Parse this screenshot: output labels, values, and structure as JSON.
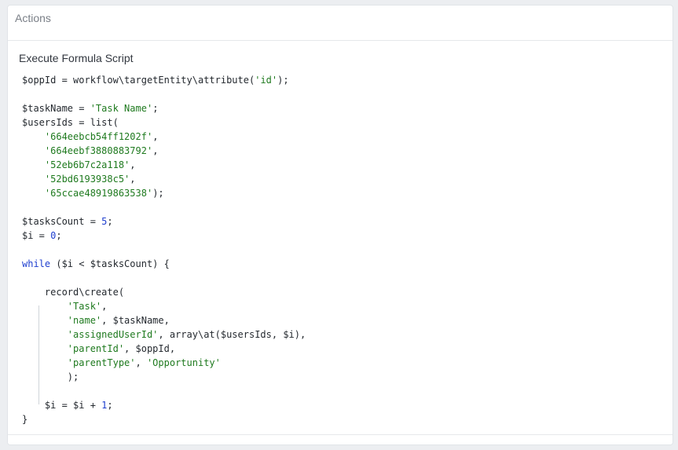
{
  "panel": {
    "title": "Actions"
  },
  "action": {
    "title": "Execute Formula Script"
  },
  "code": {
    "lines": [
      [
        {
          "t": "$oppId = workflow\\targetEntity\\attribute("
        },
        {
          "t": "'id'",
          "c": "s"
        },
        {
          "t": ");"
        }
      ],
      [],
      [
        {
          "t": "$taskName = "
        },
        {
          "t": "'Task Name'",
          "c": "s"
        },
        {
          "t": ";"
        }
      ],
      [
        {
          "t": "$usersIds = list("
        }
      ],
      [
        {
          "t": "    "
        },
        {
          "t": "'664eebcb54ff1202f'",
          "c": "s"
        },
        {
          "t": ","
        }
      ],
      [
        {
          "t": "    "
        },
        {
          "t": "'664eebf3880883792'",
          "c": "s"
        },
        {
          "t": ","
        }
      ],
      [
        {
          "t": "    "
        },
        {
          "t": "'52eb6b7c2a118'",
          "c": "s"
        },
        {
          "t": ","
        }
      ],
      [
        {
          "t": "    "
        },
        {
          "t": "'52bd6193938c5'",
          "c": "s"
        },
        {
          "t": ","
        }
      ],
      [
        {
          "t": "    "
        },
        {
          "t": "'65ccae48919863538'",
          "c": "s"
        },
        {
          "t": ");"
        }
      ],
      [],
      [
        {
          "t": "$tasksCount = "
        },
        {
          "t": "5",
          "c": "n"
        },
        {
          "t": ";"
        }
      ],
      [
        {
          "t": "$i = "
        },
        {
          "t": "0",
          "c": "n"
        },
        {
          "t": ";"
        }
      ],
      [],
      [
        {
          "t": "while",
          "c": "k"
        },
        {
          "t": " ($i < $tasksCount) {"
        }
      ],
      [],
      [
        {
          "t": "    record\\create("
        }
      ],
      [
        {
          "t": "        "
        },
        {
          "t": "'Task'",
          "c": "s"
        },
        {
          "t": ","
        }
      ],
      [
        {
          "t": "        "
        },
        {
          "t": "'name'",
          "c": "s"
        },
        {
          "t": ", $taskName,"
        }
      ],
      [
        {
          "t": "        "
        },
        {
          "t": "'assignedUserId'",
          "c": "s"
        },
        {
          "t": ", array\\at($usersIds, $i),"
        }
      ],
      [
        {
          "t": "        "
        },
        {
          "t": "'parentId'",
          "c": "s"
        },
        {
          "t": ", $oppId,"
        }
      ],
      [
        {
          "t": "        "
        },
        {
          "t": "'parentType'",
          "c": "s"
        },
        {
          "t": ", "
        },
        {
          "t": "'Opportunity'",
          "c": "s"
        }
      ],
      [
        {
          "t": "        );"
        }
      ],
      [],
      [
        {
          "t": "    $i = $i + "
        },
        {
          "t": "1",
          "c": "n"
        },
        {
          "t": ";"
        }
      ],
      [
        {
          "t": "}"
        }
      ]
    ]
  }
}
